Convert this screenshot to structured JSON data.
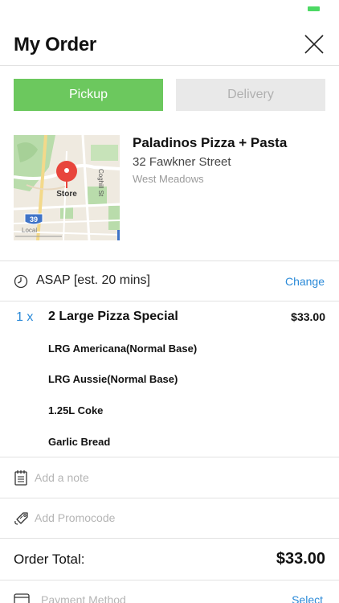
{
  "header": {
    "title": "My Order"
  },
  "order_type": {
    "pickup_label": "Pickup",
    "delivery_label": "Delivery",
    "selected": "Pickup"
  },
  "store": {
    "map_pin_label": "Store",
    "map_route_number": "39",
    "map_street_label": "Coghill St",
    "map_corner_label": "Local",
    "name": "Paladinos Pizza + Pasta",
    "street": "32 Fawkner Street",
    "suburb": "West Meadows"
  },
  "timing": {
    "text": "ASAP [est. 20 mins]",
    "change_label": "Change"
  },
  "items": [
    {
      "qty": "1 x",
      "name": "2 Large Pizza Special",
      "price": "$33.00",
      "sub_items": [
        "LRG Americana(Normal Base)",
        "LRG Aussie(Normal Base)",
        "1.25L Coke",
        "Garlic Bread"
      ]
    }
  ],
  "note": {
    "placeholder": "Add a note"
  },
  "promo": {
    "placeholder": "Add Promocode"
  },
  "total": {
    "label": "Order Total:",
    "value": "$33.00"
  },
  "payment": {
    "label": "Payment Method",
    "select_label": "Select"
  },
  "colors": {
    "accent_green": "#6cc85e",
    "link_blue": "#2b8ad8"
  }
}
